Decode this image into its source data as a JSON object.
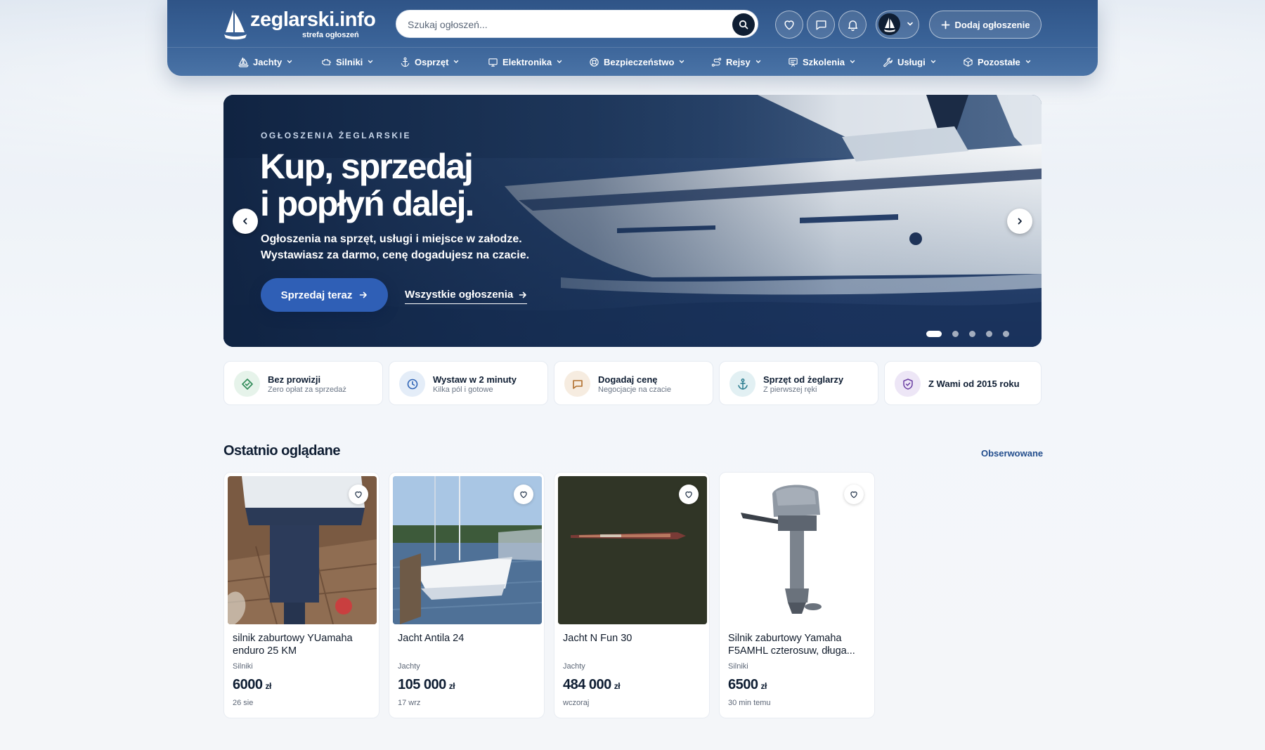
{
  "brand": {
    "title": "zeglarski.info",
    "subtitle": "strefa ogłoszeń"
  },
  "search": {
    "placeholder": "Szukaj ogłoszeń..."
  },
  "header": {
    "add_listing_label": "Dodaj ogłoszenie"
  },
  "nav": [
    {
      "label": "Jachty",
      "icon": "sailboat-icon"
    },
    {
      "label": "Silniki",
      "icon": "engine-icon"
    },
    {
      "label": "Osprzęt",
      "icon": "anchor-icon"
    },
    {
      "label": "Elektronika",
      "icon": "monitor-icon"
    },
    {
      "label": "Bezpieczeństwo",
      "icon": "lifebuoy-icon"
    },
    {
      "label": "Rejsy",
      "icon": "route-icon"
    },
    {
      "label": "Szkolenia",
      "icon": "presentation-icon"
    },
    {
      "label": "Usługi",
      "icon": "wrench-icon"
    },
    {
      "label": "Pozostałe",
      "icon": "box-icon"
    }
  ],
  "hero": {
    "eyebrow": "OGŁOSZENIA ŻEGLARSKIE",
    "title_line1": "Kup, sprzedaj",
    "title_line2": "i popłyń dalej.",
    "desc_line1": "Ogłoszenia na sprzęt, usługi i miejsce w załodze.",
    "desc_line2": "Wystawiasz za darmo, cenę dogadujesz na czacie.",
    "cta_label": "Sprzedaj teraz",
    "link_label": "Wszystkie ogłoszenia",
    "slides_total": 5,
    "active_slide": 1
  },
  "features": [
    {
      "title": "Bez prowizji",
      "subtitle": "Zero opłat za sprzedaż",
      "icon": "tag-icon",
      "color": "#2f8a57",
      "bg": "#e6f3ea"
    },
    {
      "title": "Wystaw w 2 minuty",
      "subtitle": "Kilka pól i gotowe",
      "icon": "clock-icon",
      "color": "#2f64b6",
      "bg": "#e4edf8"
    },
    {
      "title": "Dogadaj cenę",
      "subtitle": "Negocjacje na czacie",
      "icon": "chat-icon",
      "color": "#b0702e",
      "bg": "#f6ece0"
    },
    {
      "title": "Sprzęt od żeglarzy",
      "subtitle": "Z pierwszej ręki",
      "icon": "anchor-icon",
      "color": "#2a7c8f",
      "bg": "#e2f0f3"
    },
    {
      "title": "Z Wami od 2015 roku",
      "subtitle": "",
      "icon": "shield-icon",
      "color": "#6b3fa3",
      "bg": "#ede6f6"
    }
  ],
  "recent": {
    "title": "Ostatnio oglądane",
    "link_label": "Obserwowane",
    "items": [
      {
        "title": "silnik zaburtowy YUamaha enduro 25 KM",
        "category": "Silniki",
        "price": "6000",
        "currency": "zł",
        "date": "26 sie"
      },
      {
        "title": "Jacht Antila 24",
        "category": "Jachty",
        "price": "105 000",
        "currency": "zł",
        "date": "17 wrz"
      },
      {
        "title": "Jacht N Fun 30",
        "category": "Jachty",
        "price": "484 000",
        "currency": "zł",
        "date": "wczoraj"
      },
      {
        "title": "Silnik zaburtowy Yamaha F5AMHL czterosuw, długa...",
        "category": "Silniki",
        "price": "6500",
        "currency": "zł",
        "date": "30 min temu"
      }
    ]
  },
  "colors": {
    "header": "#3a6398",
    "accent": "#2f5fb6",
    "link": "#234e8d",
    "text": "#0f1e33"
  }
}
